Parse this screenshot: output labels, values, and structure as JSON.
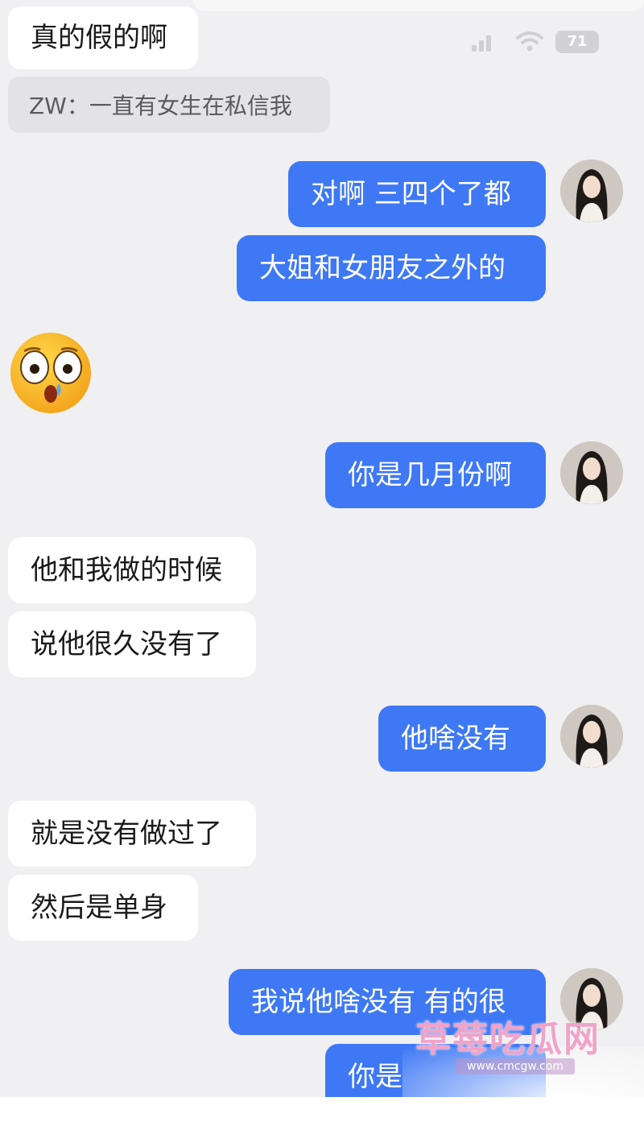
{
  "status_bar": {
    "battery": "71"
  },
  "quote_text": "ZW：一直有女生在私信我",
  "messages": [
    {
      "side": "in",
      "text": "真的假的啊"
    },
    {
      "side": "out",
      "text": "对啊 三四个了都"
    },
    {
      "side": "out",
      "text": "大姐和女朋友之外的"
    },
    {
      "side": "out",
      "text": "你是几月份啊"
    },
    {
      "side": "in",
      "text": "他和我做的时候"
    },
    {
      "side": "in",
      "text": "说他很久没有了"
    },
    {
      "side": "out",
      "text": "他啥没有"
    },
    {
      "side": "in",
      "text": "就是没有做过了"
    },
    {
      "side": "in",
      "text": "然后是单身"
    },
    {
      "side": "out",
      "text": "我说他啥没有 有的很"
    },
    {
      "side": "out",
      "text": "你是"
    }
  ],
  "icons": {
    "emoji": "astonished-drool-emoji",
    "avatar": "user-avatar-photo",
    "signal": "cellular-signal-icon",
    "wifi": "wifi-icon"
  },
  "watermark": {
    "title": "草莓吃瓜网",
    "url": "www.cmcgw.com"
  },
  "colors": {
    "background": "#f0f0f2",
    "outgoing": "#3e78f4",
    "incoming": "#ffffff"
  }
}
